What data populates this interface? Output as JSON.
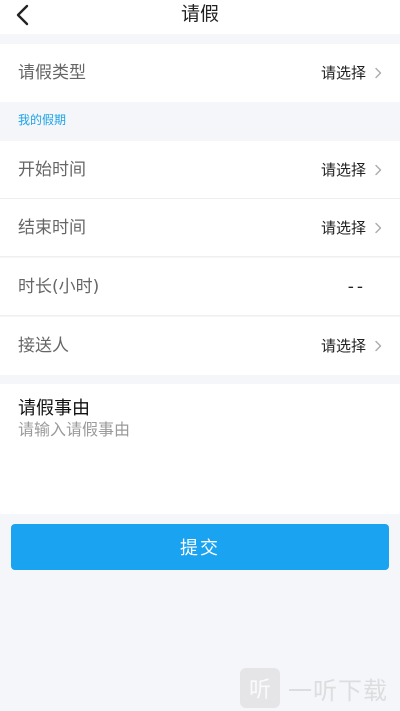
{
  "header": {
    "title": "请假"
  },
  "leave_type": {
    "label": "请假类型",
    "value": "请选择"
  },
  "section": {
    "title": "我的假期"
  },
  "fields": [
    {
      "label": "开始时间",
      "value": "请选择"
    },
    {
      "label": "结束时间",
      "value": "请选择"
    },
    {
      "label": "时长(小时)",
      "value": "--"
    },
    {
      "label": "接送人",
      "value": "请选择"
    }
  ],
  "reason": {
    "title": "请假事由",
    "placeholder": "请输入请假事由"
  },
  "submit": {
    "label": "提交"
  },
  "watermark": {
    "logo": "听",
    "text": "一听下载"
  },
  "colors": {
    "accent": "#1aa3f0",
    "section_title": "#1aa3e6",
    "background": "#f5f6fa"
  }
}
